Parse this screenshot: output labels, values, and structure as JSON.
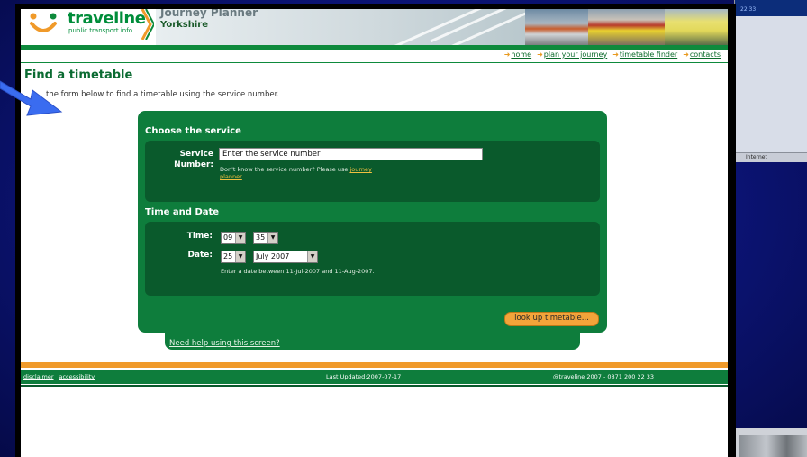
{
  "background": {
    "color": "#0d1680",
    "right_window_status": "Internet",
    "right_window_bar": "22 33"
  },
  "header": {
    "logo_name": "traveline",
    "logo_tagline": "public transport info",
    "app_title": "Journey Planner",
    "region": "Yorkshire"
  },
  "nav": {
    "links": [
      "home",
      "plan your journey",
      "timetable finder",
      "contacts"
    ]
  },
  "page": {
    "title": "Find a timetable",
    "intro": "the form below to find a timetable using the service number."
  },
  "form": {
    "section_service": "Choose the service",
    "service_label_1": "Service",
    "service_label_2": "Number:",
    "service_value": "Enter the service number",
    "hint_text": "Don't know the service number? Please use",
    "hint_link_1": "journey",
    "hint_link_2": "planner",
    "section_time": "Time and Date",
    "time_label": "Time:",
    "hour": "09",
    "minute": "35",
    "date_label": "Date:",
    "day": "25",
    "month": "July 2007",
    "date_hint": "Enter a date between 11-Jul-2007 and 11-Aug-2007.",
    "lookup_button": "look up timetable...",
    "help_link": "Need help using this screen?"
  },
  "footer": {
    "links": [
      "disclaimer",
      "accessibility"
    ],
    "last_updated": "Last Updated:2007-07-17",
    "copyright": "@traveline 2007 - 0871 200 22 33"
  },
  "colors": {
    "brand_green": "#0e7d3c",
    "dark_green": "#0a5a2c",
    "orange": "#f09a2a",
    "pointer_blue": "#3a6cf0"
  }
}
